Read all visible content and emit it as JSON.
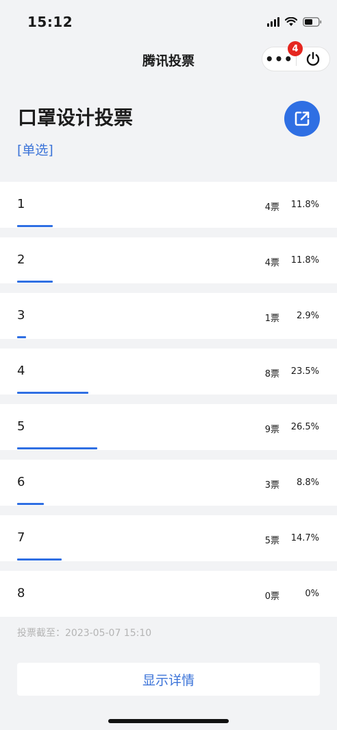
{
  "status_bar": {
    "time": "15:12",
    "icons": [
      "signal-icon",
      "wifi-icon",
      "battery-icon"
    ]
  },
  "nav": {
    "title": "腾讯投票",
    "more_icon": "more-icon",
    "badge_count": "4",
    "close_icon": "power-icon"
  },
  "vote": {
    "title": "口罩设计投票",
    "type": "[单选]",
    "share_icon": "share-icon"
  },
  "options": [
    {
      "label": "1",
      "votes": "4票",
      "percent": "11.8%",
      "fraction": 0.118
    },
    {
      "label": "2",
      "votes": "4票",
      "percent": "11.8%",
      "fraction": 0.118
    },
    {
      "label": "3",
      "votes": "1票",
      "percent": "2.9%",
      "fraction": 0.029
    },
    {
      "label": "4",
      "votes": "8票",
      "percent": "23.5%",
      "fraction": 0.235
    },
    {
      "label": "5",
      "votes": "9票",
      "percent": "26.5%",
      "fraction": 0.265
    },
    {
      "label": "6",
      "votes": "3票",
      "percent": "8.8%",
      "fraction": 0.088
    },
    {
      "label": "7",
      "votes": "5票",
      "percent": "14.7%",
      "fraction": 0.147
    },
    {
      "label": "8",
      "votes": "0票",
      "percent": "0%",
      "fraction": 0
    }
  ],
  "footer": {
    "deadline": "投票截至：2023-05-07 15:10",
    "detail_button": "显示详情"
  },
  "colors": {
    "accent": "#2f6fe3",
    "link": "#3b73d8",
    "badge": "#e5261f",
    "background": "#f2f3f5"
  }
}
